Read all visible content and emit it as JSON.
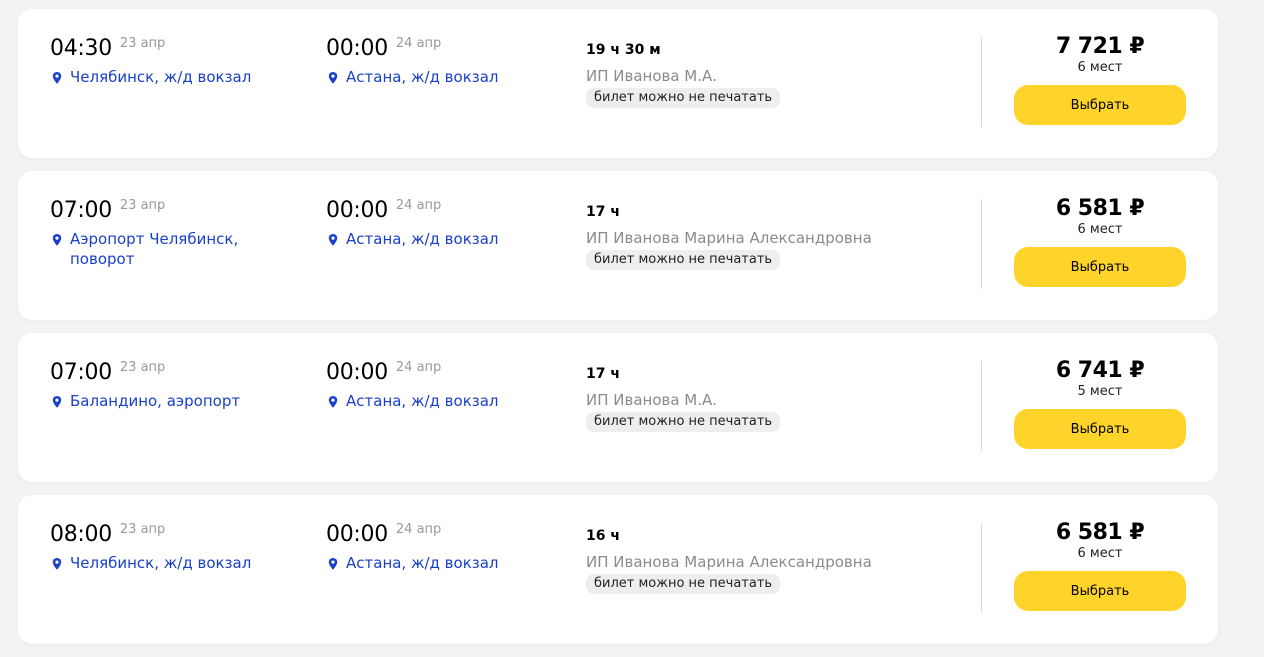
{
  "colors": {
    "accent_button": "#fed42b",
    "link_blue": "#1a40c9",
    "muted": "#8b8b8b"
  },
  "icons": {
    "location": "location-pin-icon"
  },
  "trips": [
    {
      "departure": {
        "time": "04:30",
        "date": "23 апр",
        "place": "Челябинск, ж/д вокзал"
      },
      "arrival": {
        "time": "00:00",
        "date": "24 апр",
        "place": "Астана, ж/д вокзал"
      },
      "duration": "19 ч 30 м",
      "carrier": "ИП Иванова М.А.",
      "badge": "билет можно не печатать",
      "price": "7 721 ₽",
      "seats": "6 мест",
      "button_label": "Выбрать"
    },
    {
      "departure": {
        "time": "07:00",
        "date": "23 апр",
        "place": "Аэропорт Челябинск, поворот"
      },
      "arrival": {
        "time": "00:00",
        "date": "24 апр",
        "place": "Астана, ж/д вокзал"
      },
      "duration": "17 ч",
      "carrier": "ИП Иванова Марина Александровна",
      "badge": "билет можно не печатать",
      "price": "6 581 ₽",
      "seats": "6 мест",
      "button_label": "Выбрать"
    },
    {
      "departure": {
        "time": "07:00",
        "date": "23 апр",
        "place": "Баландино, аэропорт"
      },
      "arrival": {
        "time": "00:00",
        "date": "24 апр",
        "place": "Астана, ж/д вокзал"
      },
      "duration": "17 ч",
      "carrier": "ИП Иванова М.А.",
      "badge": "билет можно не печатать",
      "price": "6 741 ₽",
      "seats": "5 мест",
      "button_label": "Выбрать"
    },
    {
      "departure": {
        "time": "08:00",
        "date": "23 апр",
        "place": "Челябинск, ж/д вокзал"
      },
      "arrival": {
        "time": "00:00",
        "date": "24 апр",
        "place": "Астана, ж/д вокзал"
      },
      "duration": "16 ч",
      "carrier": "ИП Иванова Марина Александровна",
      "badge": "билет можно не печатать",
      "price": "6 581 ₽",
      "seats": "6 мест",
      "button_label": "Выбрать"
    }
  ]
}
